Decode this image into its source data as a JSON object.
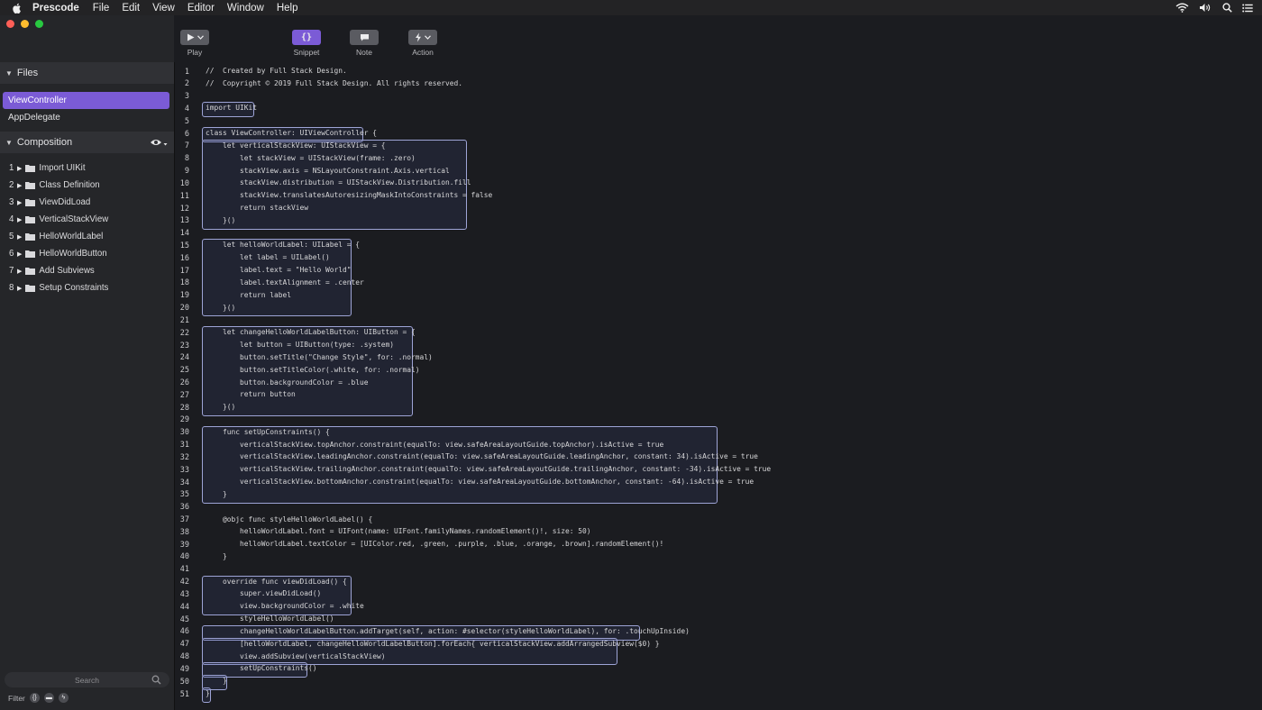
{
  "menubar": {
    "app_name": "Prescode",
    "items": [
      "File",
      "Edit",
      "View",
      "Editor",
      "Window",
      "Help"
    ]
  },
  "toolbar": {
    "buttons": [
      {
        "label": "Play",
        "icon": "play-icon"
      },
      {
        "label": "Snippet",
        "icon": "braces-icon"
      },
      {
        "label": "Note",
        "icon": "note-icon"
      },
      {
        "label": "Action",
        "icon": "bolt-icon"
      }
    ]
  },
  "sidebar": {
    "files_header": "Files",
    "files": [
      "ViewController",
      "AppDelegate"
    ],
    "active_file": "ViewController",
    "composition_header": "Composition",
    "composition": [
      {
        "num": "1",
        "label": "Import UIKit"
      },
      {
        "num": "2",
        "label": "Class Definition"
      },
      {
        "num": "3",
        "label": "ViewDidLoad"
      },
      {
        "num": "4",
        "label": "VerticalStackView"
      },
      {
        "num": "5",
        "label": "HelloWorldLabel"
      },
      {
        "num": "6",
        "label": "HelloWorldButton"
      },
      {
        "num": "7",
        "label": "Add Subviews"
      },
      {
        "num": "8",
        "label": "Setup Constraints"
      }
    ],
    "search_placeholder": "Search",
    "filter_label": "Filter"
  },
  "editor": {
    "lines": [
      "//  Created by Full Stack Design.",
      "//  Copyright © 2019 Full Stack Design. All rights reserved.",
      "",
      "import UIKit",
      "",
      "class ViewController: UIViewController {",
      "    let verticalStackView: UIStackView = {",
      "        let stackView = UIStackView(frame: .zero)",
      "        stackView.axis = NSLayoutConstraint.Axis.vertical",
      "        stackView.distribution = UIStackView.Distribution.fill",
      "        stackView.translatesAutoresizingMaskIntoConstraints = false",
      "        return stackView",
      "    }()",
      "",
      "    let helloWorldLabel: UILabel = {",
      "        let label = UILabel()",
      "        label.text = \"Hello World\"",
      "        label.textAlignment = .center",
      "        return label",
      "    }()",
      "",
      "    let changeHelloWorldLabelButton: UIButton = {",
      "        let button = UIButton(type: .system)",
      "        button.setTitle(\"Change Style\", for: .normal)",
      "        button.setTitleColor(.white, for: .normal)",
      "        button.backgroundColor = .blue",
      "        return button",
      "    }()",
      "",
      "    func setUpConstraints() {",
      "        verticalStackView.topAnchor.constraint(equalTo: view.safeAreaLayoutGuide.topAnchor).isActive = true",
      "        verticalStackView.leadingAnchor.constraint(equalTo: view.safeAreaLayoutGuide.leadingAnchor, constant: 34).isActive = true",
      "        verticalStackView.trailingAnchor.constraint(equalTo: view.safeAreaLayoutGuide.trailingAnchor, constant: -34).isActive = true",
      "        verticalStackView.bottomAnchor.constraint(equalTo: view.safeAreaLayoutGuide.bottomAnchor, constant: -64).isActive = true",
      "    }",
      "",
      "    @objc func styleHelloWorldLabel() {",
      "        helloWorldLabel.font = UIFont(name: UIFont.familyNames.randomElement()!, size: 50)",
      "        helloWorldLabel.textColor = [UIColor.red, .green, .purple, .blue, .orange, .brown].randomElement()!",
      "    }",
      "",
      "    override func viewDidLoad() {",
      "        super.viewDidLoad()",
      "        view.backgroundColor = .white",
      "        styleHelloWorldLabel()",
      "        changeHelloWorldLabelButton.addTarget(self, action: #selector(styleHelloWorldLabel), for: .touchUpInside)",
      "        [helloWorldLabel, changeHelloWorldLabelButton].forEach{ verticalStackView.addArrangedSubview($0) }",
      "        view.addSubview(verticalStackView)",
      "        setUpConstraints()",
      "    }",
      "}"
    ]
  },
  "colors": {
    "accent_purple": "#7b5bd6",
    "block_outline": "#9ea4d6",
    "traffic_red": "#fe5f57",
    "traffic_yellow": "#febc2e",
    "traffic_green": "#28c840"
  }
}
